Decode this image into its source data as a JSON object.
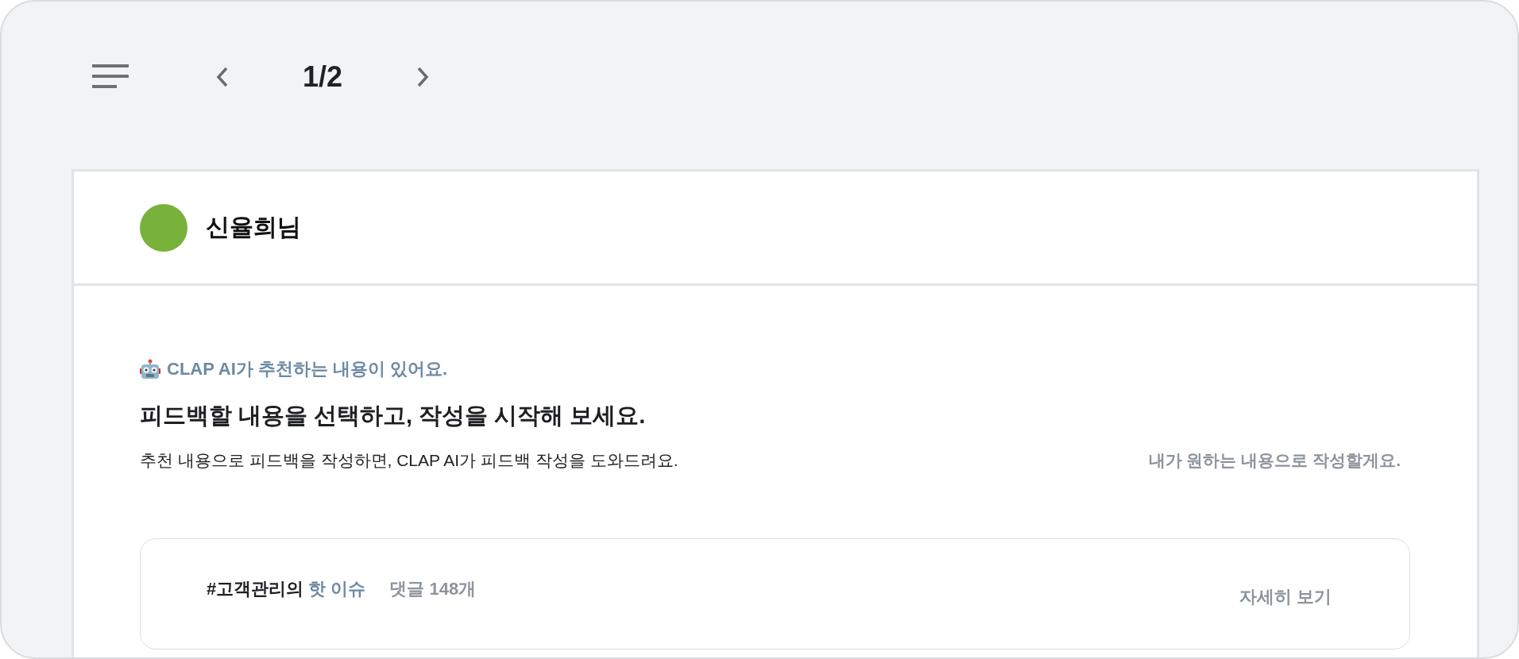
{
  "toolbar": {
    "page_indicator": "1/2"
  },
  "recipient": {
    "name": "신율희님"
  },
  "recommendation": {
    "ai_notice": "CLAP AI가 추천하는 내용이 있어요.",
    "headline": "피드백할 내용을 선택하고, 작성을 시작해 보세요.",
    "description": "추천 내용으로 피드백을 작성하면, CLAP AI가 피드백 작성을 도와드려요.",
    "custom_link": "내가 원하는 내용으로 작성할게요."
  },
  "topic_card": {
    "topic": "#고객관리의",
    "highlight": "핫 이슈",
    "comments": "댓글 148개",
    "details_link": "자세히 보기"
  }
}
